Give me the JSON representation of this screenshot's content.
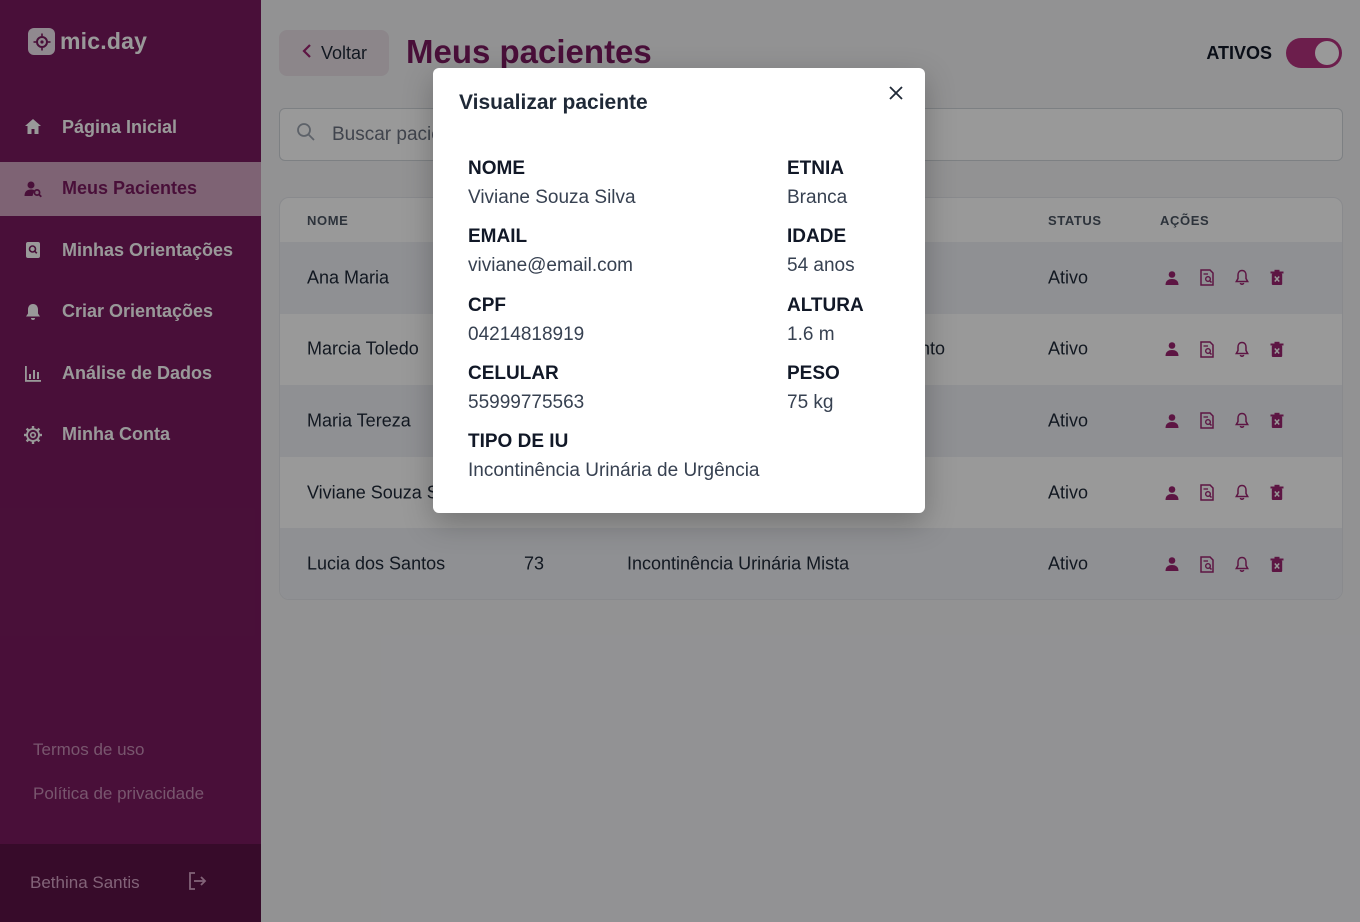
{
  "app": {
    "brand": "mic.day"
  },
  "sidebar": {
    "items": [
      {
        "label": "Página Inicial",
        "icon": "home-icon"
      },
      {
        "label": "Meus Pacientes",
        "icon": "user-search-icon"
      },
      {
        "label": "Minhas Orientações",
        "icon": "document-search-icon"
      },
      {
        "label": "Criar Orientações",
        "icon": "bell-icon"
      },
      {
        "label": "Análise de Dados",
        "icon": "bar-chart-icon"
      },
      {
        "label": "Minha Conta",
        "icon": "gear-icon"
      }
    ],
    "links": {
      "terms": "Termos de uso",
      "privacy": "Política de privacidade"
    },
    "user": "Bethina Santis"
  },
  "header": {
    "back_label": "Voltar",
    "title": "Meus pacientes",
    "toggle_label": "ATIVOS",
    "toggle_on": true
  },
  "search": {
    "placeholder": "Buscar paciente"
  },
  "table": {
    "columns": [
      "NOME",
      "STATUS",
      "AÇÕES"
    ],
    "rows": [
      {
        "name": "Ana Maria",
        "age": "",
        "type": "",
        "status": "Ativo"
      },
      {
        "name": "Marcia Toledo",
        "age": "",
        "type": "ento",
        "status": "Ativo"
      },
      {
        "name": "Maria Tereza",
        "age": "",
        "type": "",
        "status": "Ativo"
      },
      {
        "name": "Viviane Souza Si",
        "age": "",
        "type": "",
        "status": "Ativo"
      },
      {
        "name": "Lucia dos Santos",
        "age": "73",
        "type": "Incontinência Urinária Mista",
        "status": "Ativo"
      }
    ]
  },
  "modal": {
    "title": "Visualizar paciente",
    "fields": {
      "nome": {
        "label": "NOME",
        "value": "Viviane Souza Silva"
      },
      "etnia": {
        "label": "ETNIA",
        "value": "Branca"
      },
      "email": {
        "label": "EMAIL",
        "value": "viviane@email.com"
      },
      "idade": {
        "label": "IDADE",
        "value": "54 anos"
      },
      "cpf": {
        "label": "CPF",
        "value": "04214818919"
      },
      "altura": {
        "label": "ALTURA",
        "value": "1.6 m"
      },
      "celular": {
        "label": "CELULAR",
        "value": "55999775563"
      },
      "peso": {
        "label": "PESO",
        "value": "75 kg"
      },
      "tipo_iu": {
        "label": "TIPO DE IU",
        "value": "Incontinência Urinária de Urgência"
      }
    }
  },
  "colors": {
    "brand": "#7a1a5f",
    "accent": "#b5337f",
    "icon": "#9b2470"
  }
}
